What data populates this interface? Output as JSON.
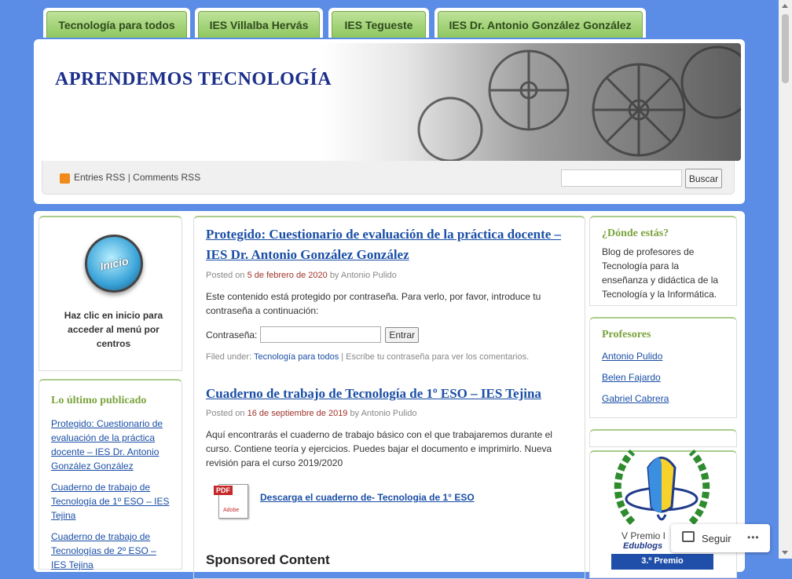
{
  "tabs": [
    {
      "label": "Tecnología para todos"
    },
    {
      "label": "IES Villalba Hervás"
    },
    {
      "label": "IES Tegueste"
    },
    {
      "label": "IES Dr. Antonio González González"
    }
  ],
  "header": {
    "site_title": "APRENDEMOS TECNOLOGÍA",
    "rss_entries": "Entries RSS",
    "rss_separator": "|",
    "rss_comments": "Comments RSS",
    "search_button": "Buscar"
  },
  "left": {
    "inicio_label": "Inicio",
    "inicio_text": "Haz clic en inicio para acceder al menú por centros",
    "latest_title": "Lo último publicado",
    "latest_items": [
      "Protegido: Cuestionario de evaluación de la práctica docente – IES Dr. Antonio González González",
      "Cuaderno de trabajo de Tecnología de 1º ESO – IES Tejina",
      "Cuaderno de trabajo de Tecnologías de 2º ESO – IES Tejina"
    ]
  },
  "posts": [
    {
      "title": "Protegido: Cuestionario de evaluación de la práctica docente – IES Dr. Antonio González González",
      "posted_on": "Posted on",
      "date": "5 de febrero de 2020",
      "by": "by Antonio Pulido",
      "text": "Este contenido está protegido por contraseña. Para verlo, por favor, introduce tu contraseña a continuación:",
      "password_label": "Contraseña:",
      "enter_button": "Entrar",
      "filed_under": "Filed under:",
      "category": "Tecnología para todos",
      "comments_note": "| Escribe tu contraseña para ver los comentarios."
    },
    {
      "title": "Cuaderno de trabajo de Tecnología de 1º ESO – IES Tejina",
      "posted_on": "Posted on",
      "date": "16 de septiembre de 2019",
      "by": "by Antonio Pulido",
      "text": "Aquí encontrarás el cuaderno de trabajo básico con el que trabajaremos durante el curso. Contiene teoría y ejercicios. Puedes bajar el documento e imprimirlo. Nueva revisión para el curso 2019/2020",
      "pdf_label": "PDF",
      "pdf_brand": "Adobe",
      "download_link": "Descarga el cuaderno de- Tecnologia de 1° ESO"
    }
  ],
  "sponsored_heading": "Sponsored Content",
  "right": {
    "where_title": "¿Dónde estás?",
    "where_text": "Blog de profesores de Tecnología para la enseñanza y didáctica de la Tecnología y la Informática.",
    "teachers_title": "Profesores",
    "teachers": [
      "Antonio Pulido",
      "Belen Fajardo",
      "Gabriel Cabrera"
    ],
    "award_text": "V Premio I",
    "award_brand": "Edublogs",
    "award_ribbon": "3.º Premio"
  },
  "follow": {
    "label": "Seguir",
    "more": "•••"
  },
  "colors": {
    "page_bg": "#5b8de6",
    "tab_green": "#9fd16f",
    "link": "#1a4ea6",
    "widget_title": "#7aa33d",
    "date_red": "#a0342a"
  }
}
